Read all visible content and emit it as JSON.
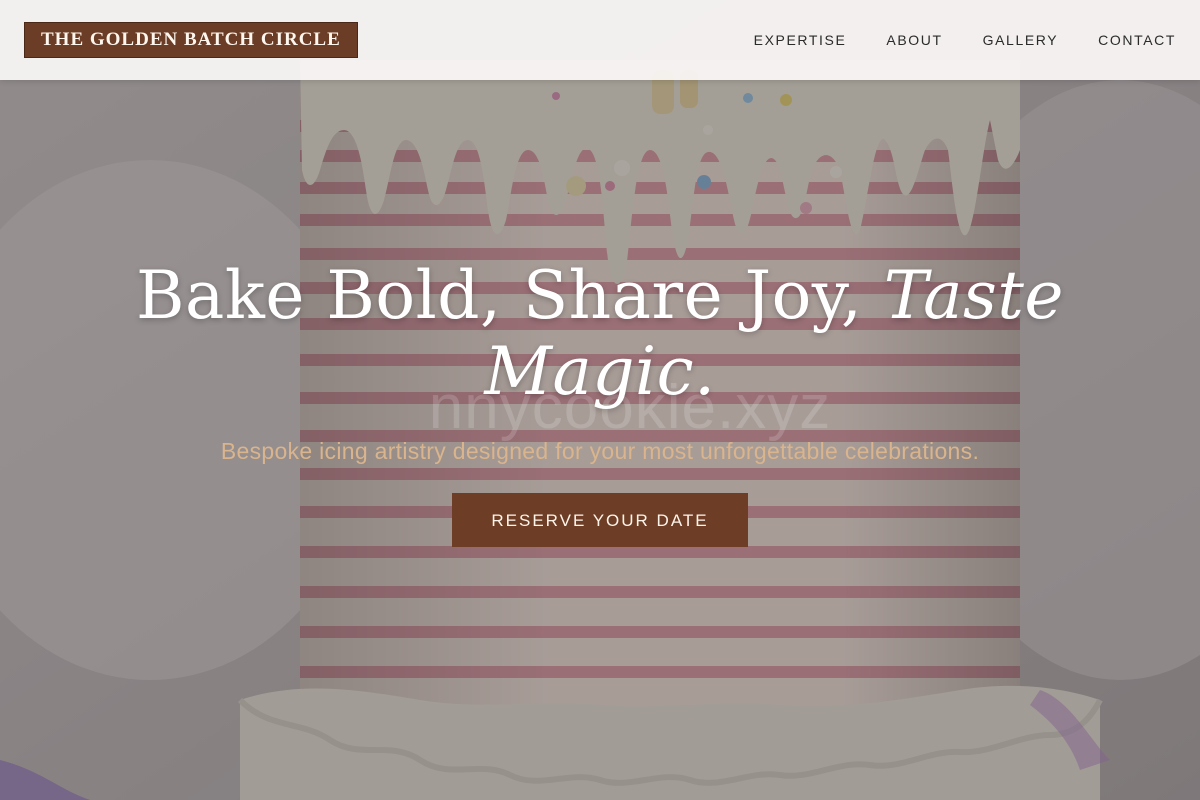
{
  "brand": {
    "name": "THE GOLDEN BATCH CIRCLE"
  },
  "nav": {
    "items": [
      {
        "label": "EXPERTISE"
      },
      {
        "label": "ABOUT"
      },
      {
        "label": "GALLERY"
      },
      {
        "label": "CONTACT"
      }
    ]
  },
  "hero": {
    "headline_main": "Bake Bold, Share Joy, ",
    "headline_italic": "Taste Magic.",
    "subtitle": "Bespoke icing artistry designed for your most unforgettable celebrations.",
    "cta_label": "RESERVE YOUR DATE",
    "watermark": "nnycookie.xyz",
    "background_image": "drip-cake-photo"
  },
  "colors": {
    "brand_brown": "#6b3d27",
    "cta_brown": "#6d3e25",
    "subtitle_gold": "#d9b48c",
    "header_bg": "#faf8f6"
  }
}
